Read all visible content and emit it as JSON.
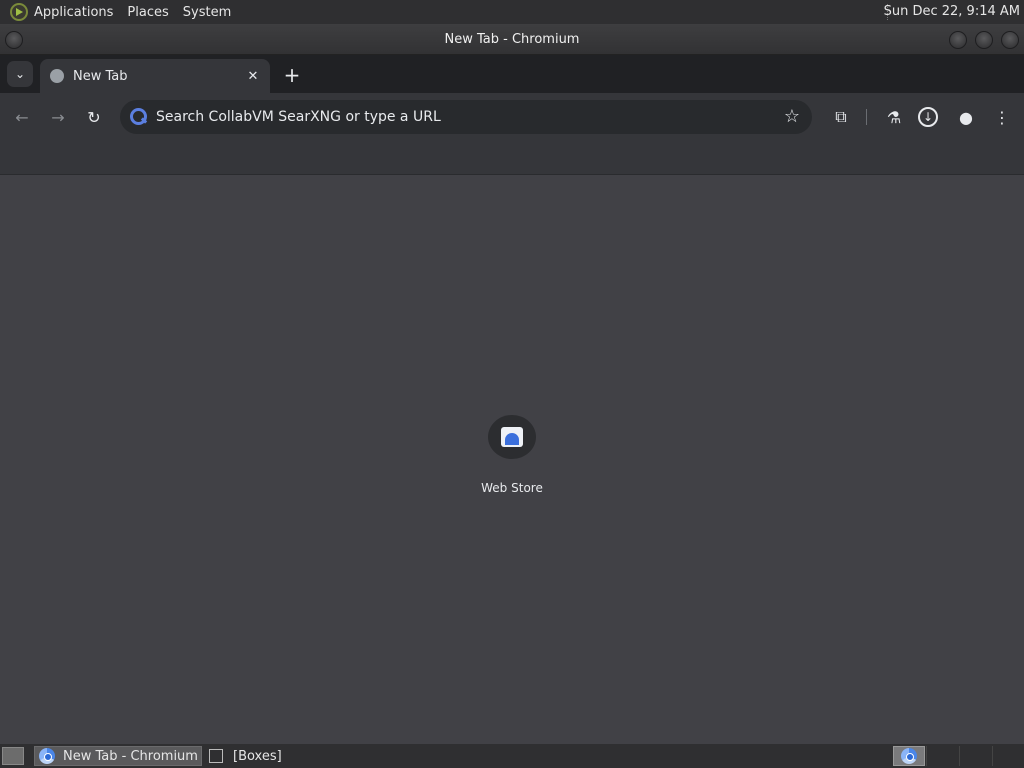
{
  "top_panel": {
    "menus": [
      "Applications",
      "Places",
      "System"
    ],
    "clock": "Sun Dec 22,  9:14 AM"
  },
  "window": {
    "title": "New Tab - Chromium"
  },
  "tabs": [
    {
      "label": "New Tab",
      "close": "✕"
    }
  ],
  "tabstrip": {
    "search_tabs_icon": "⌄",
    "new_tab_icon": "+"
  },
  "toolbar": {
    "back": "←",
    "forward": "→",
    "reload": "↻",
    "omnibox_placeholder": "Search CollabVM SearXNG or type a URL",
    "bookmark_star": "☆",
    "extensions": "⧉",
    "labs": "⚗",
    "download": "↓",
    "profile": "●",
    "menu": "⋮"
  },
  "shortcuts": [
    {
      "label": "Web Store"
    }
  ],
  "taskbar": {
    "tasks": [
      {
        "label": "New Tab - Chromium"
      },
      {
        "label": "[Boxes]"
      }
    ]
  }
}
